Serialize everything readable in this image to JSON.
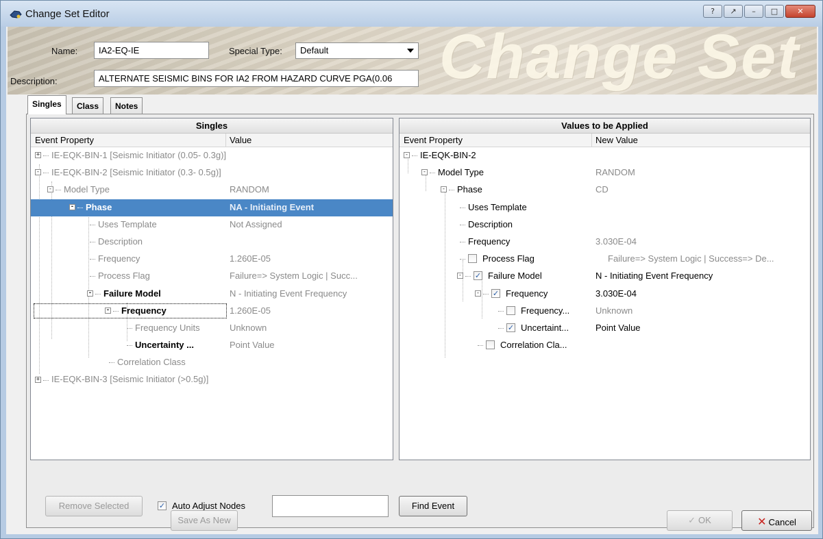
{
  "window": {
    "title": "Change Set Editor",
    "buttons": {
      "help": "?",
      "restore_special": "↗",
      "minimize": "–",
      "maximize": "□",
      "close": "✕"
    }
  },
  "header": {
    "name_label": "Name:",
    "name_value": "IA2-EQ-IE",
    "special_type_label": "Special Type:",
    "special_type_value": "Default",
    "description_label": "Description:",
    "description_value": "ALTERNATE SEISMIC BINS FOR IA2 FROM HAZARD CURVE PGA(0.06",
    "watermark": "Change Set"
  },
  "tabs": [
    {
      "label": "Singles",
      "active": true
    },
    {
      "label": "Class",
      "active": false
    },
    {
      "label": "Notes",
      "active": false
    }
  ],
  "singles_panel": {
    "title": "Singles",
    "col1": "Event Property",
    "col2": "Value",
    "rows": [
      {
        "text": "IE-EQK-BIN-1  [Seismic Initiator (0.05- 0.3g)]",
        "value": ""
      },
      {
        "text": "IE-EQK-BIN-2  [Seismic Initiator (0.3- 0.5g)]",
        "value": ""
      },
      {
        "text": "Model Type",
        "value": "RANDOM"
      },
      {
        "text": "Phase",
        "value": "NA - Initiating Event"
      },
      {
        "text": "Uses Template",
        "value": "Not Assigned"
      },
      {
        "text": "Description",
        "value": ""
      },
      {
        "text": "Frequency",
        "value": "1.260E-05"
      },
      {
        "text": "Process Flag",
        "value": "Failure=> System Logic   | Succ..."
      },
      {
        "text": "Failure Model",
        "value": "N - Initiating Event Frequency"
      },
      {
        "text": "Frequency",
        "value": "1.260E-05"
      },
      {
        "text": "Frequency Units",
        "value": "Unknown"
      },
      {
        "text": "Uncertainty ...",
        "value": "Point Value"
      },
      {
        "text": "Correlation Class",
        "value": ""
      },
      {
        "text": "IE-EQK-BIN-3  [Seismic Initiator (>0.5g)]",
        "value": ""
      }
    ]
  },
  "values_panel": {
    "title": "Values to be Applied",
    "col1": "Event Property",
    "col2": "New Value",
    "rows": [
      {
        "text": "IE-EQK-BIN-2",
        "value": ""
      },
      {
        "text": "Model Type",
        "value": "RANDOM"
      },
      {
        "text": "Phase",
        "value": "CD"
      },
      {
        "text": "Uses Template",
        "value": ""
      },
      {
        "text": "Description",
        "value": ""
      },
      {
        "text": "Frequency",
        "value": "3.030E-04"
      },
      {
        "text": "Process Flag",
        "value": "Failure=> System Logic   | Success=> De..."
      },
      {
        "text": "Failure Model",
        "value": "N - Initiating Event Frequency"
      },
      {
        "text": "Frequency",
        "value": "3.030E-04"
      },
      {
        "text": "Frequency...",
        "value": "Unknown"
      },
      {
        "text": "Uncertaint...",
        "value": "Point Value"
      },
      {
        "text": "Correlation Cla...",
        "value": ""
      }
    ]
  },
  "bottom": {
    "remove_selected": "Remove Selected",
    "auto_adjust_label": "Auto Adjust Nodes",
    "auto_adjust_checked": true,
    "find_input_value": "",
    "find_event": "Find Event",
    "save_as_new": "Save As New",
    "ok": "OK",
    "cancel": "Cancel"
  },
  "colors": {
    "selection": "#4a87c6",
    "cancel_x": "#c8201c",
    "check": "#2a5ea8"
  }
}
